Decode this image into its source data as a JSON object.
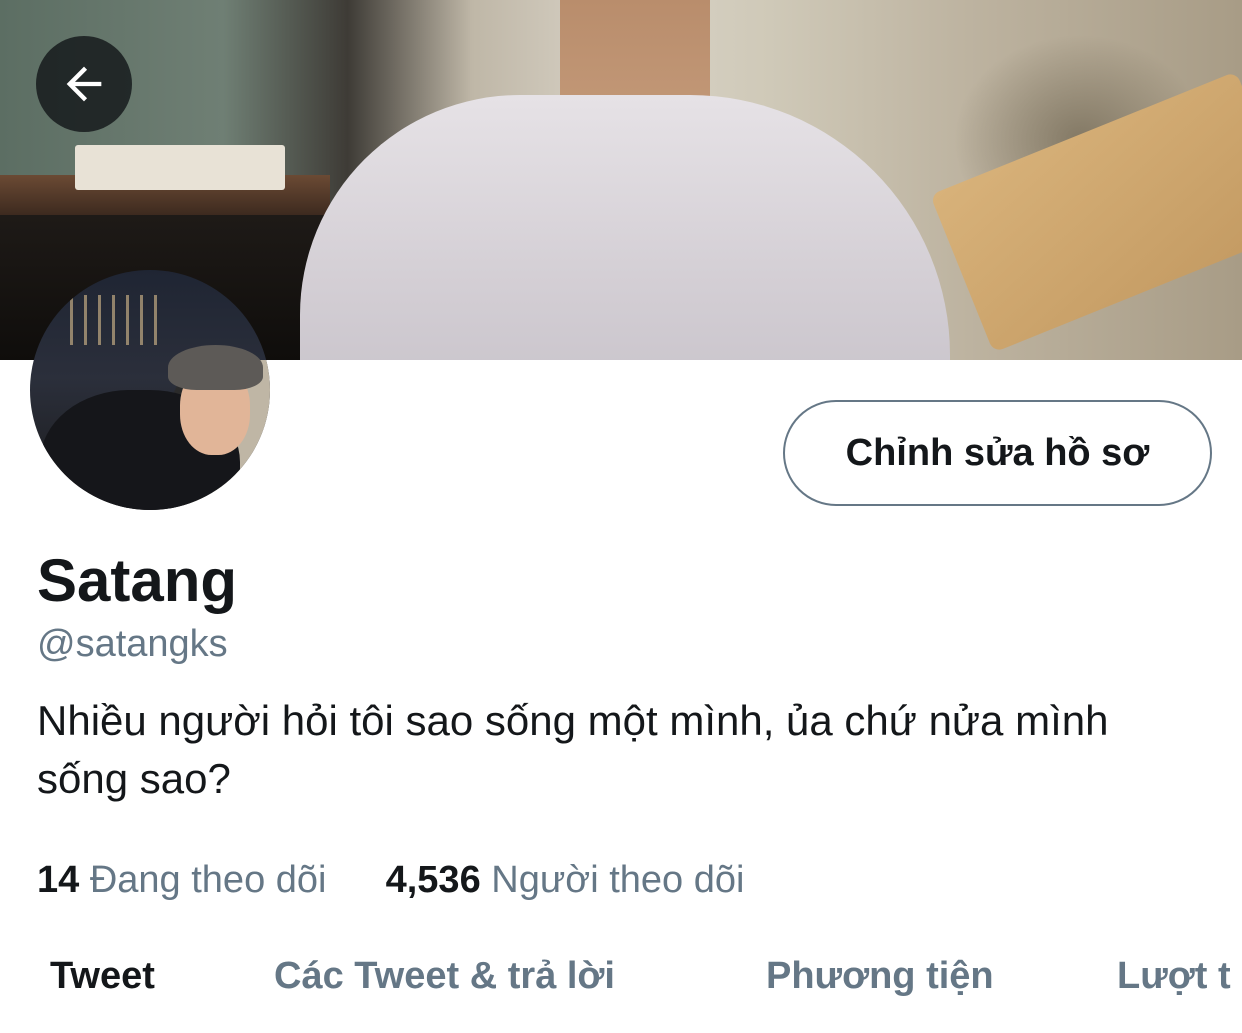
{
  "header": {
    "back_icon": "arrow-left-icon"
  },
  "profile": {
    "name": "Satang",
    "handle": "@satangks",
    "bio": "Nhiều người hỏi tôi sao sống một mình, ủa chứ nửa mình sống sao?",
    "edit_profile_label": "Chỉnh sửa hồ sơ"
  },
  "stats": {
    "following_count": "14",
    "following_label": "Đang theo dõi",
    "followers_count": "4,536",
    "followers_label": "Người theo dõi"
  },
  "tabs": [
    {
      "label": "Tweet",
      "active": true
    },
    {
      "label": "Các Tweet & trả lời",
      "active": false
    },
    {
      "label": "Phương tiện",
      "active": false
    },
    {
      "label": "Lượt t",
      "active": false
    }
  ],
  "colors": {
    "primary_text": "#14171a",
    "secondary_text": "#657786",
    "button_border": "#657786"
  }
}
